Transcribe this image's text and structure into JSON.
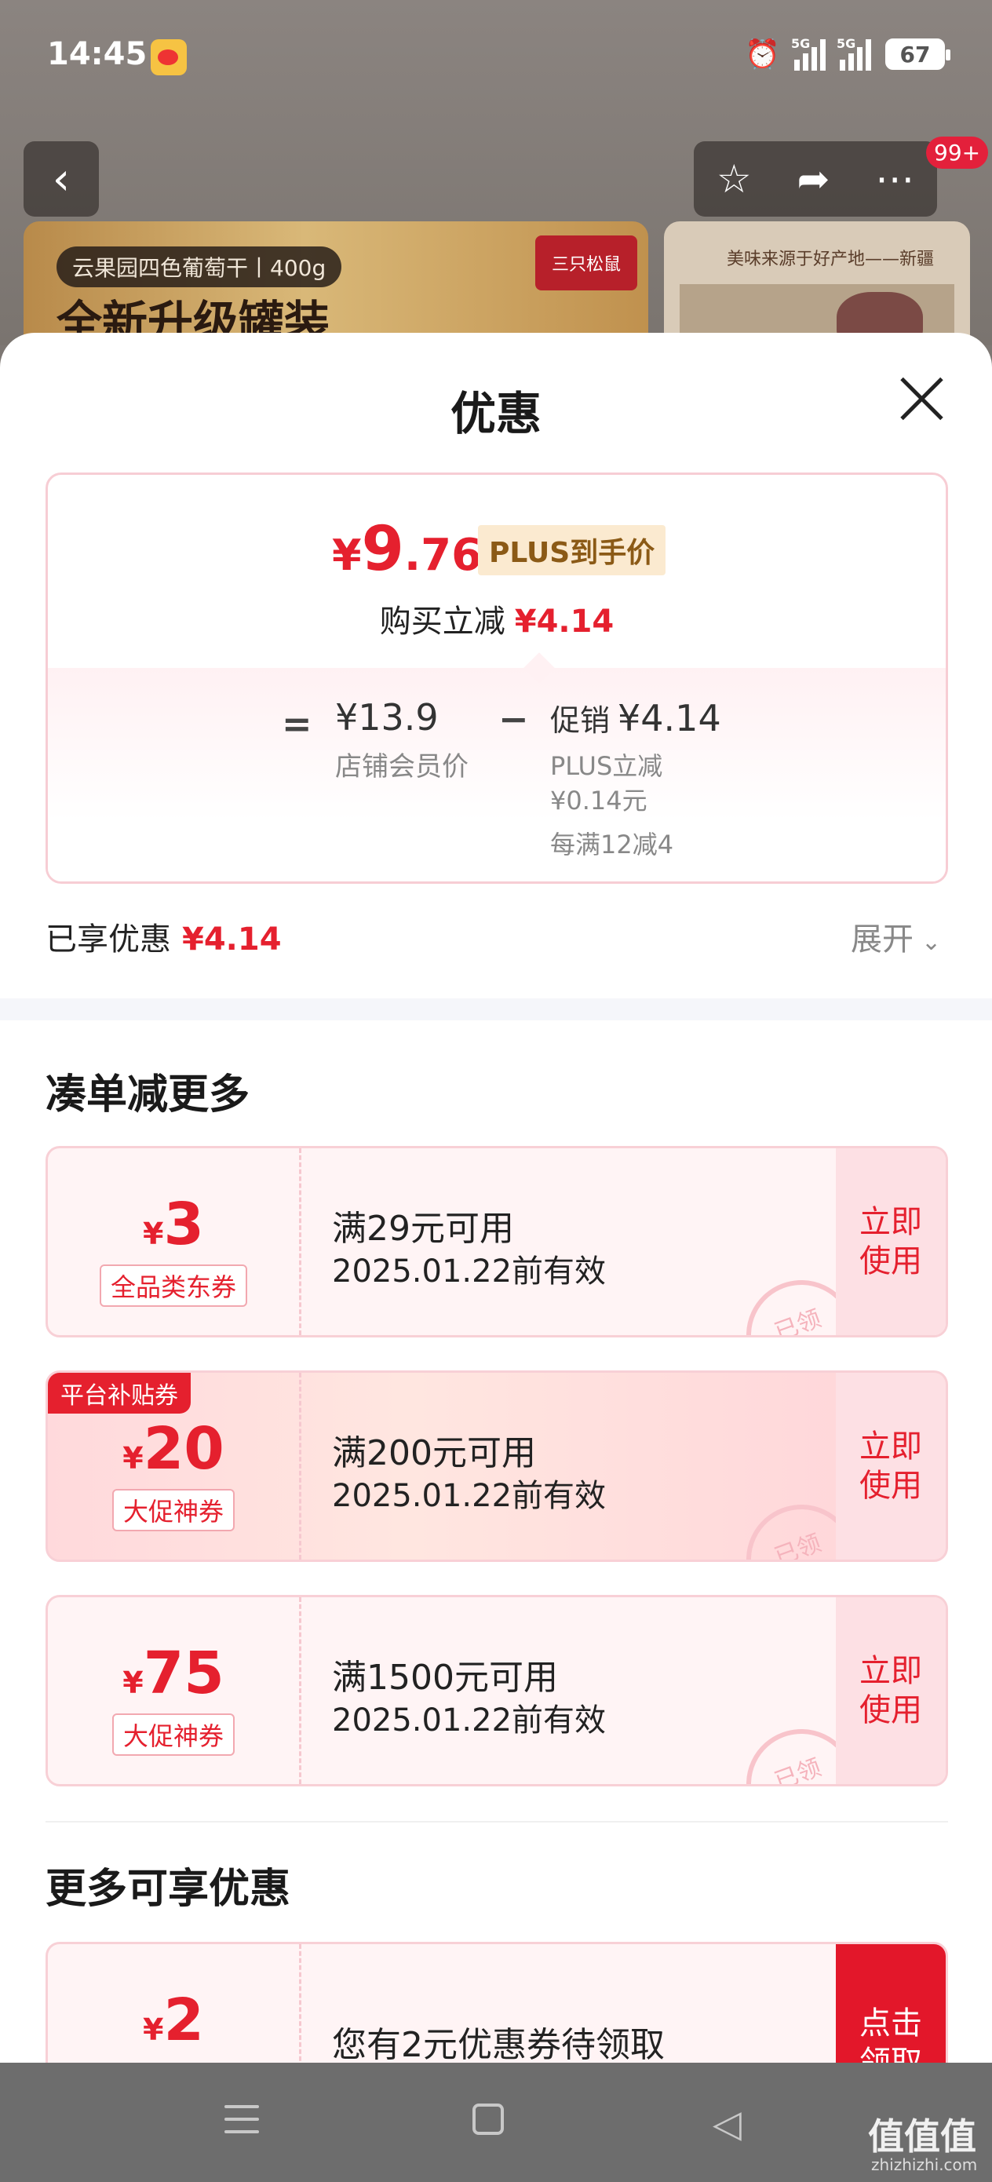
{
  "status": {
    "time": "14:45",
    "net1": "5G",
    "net2": "5G",
    "battery": "67"
  },
  "topnav": {
    "badge": "99+"
  },
  "background_product": {
    "pill": "云果园四色葡萄干丨400g",
    "headline": "全新升级罐装",
    "brand": "三只松鼠",
    "side_text": "美味来源于好产地——新疆"
  },
  "sheet": {
    "title": "优惠"
  },
  "price_box": {
    "currency": "¥",
    "price_int": "9",
    "price_dec": ".76",
    "plus_tag": "PLUS到手价",
    "reduce_label": "购买立减",
    "reduce_amount": "¥4.14",
    "equals": "=",
    "member_price": "¥13.9",
    "member_label": "店铺会员价",
    "minus": "−",
    "promo_label": "促销",
    "promo_amount": "¥4.14",
    "plus_reduce": "PLUS立减",
    "plus_reduce_amount": "¥0.14元",
    "rule": "每满12减4"
  },
  "enjoyed": {
    "label": "已享优惠",
    "amount": "¥4.14",
    "expand": "展开",
    "chevron": "⌄"
  },
  "section1": {
    "title": "凑单减更多"
  },
  "coupons": [
    {
      "currency": "¥",
      "amount": "3",
      "kind": "全品类东券",
      "condition": "满29元可用",
      "date": "2025.01.22前有效",
      "action_line1": "立即",
      "action_line2": "使用",
      "stamp": "已领"
    },
    {
      "platform_tag": "平台补贴券",
      "currency": "¥",
      "amount": "20",
      "kind": "大促神券",
      "condition": "满200元可用",
      "date": "2025.01.22前有效",
      "action_line1": "立即",
      "action_line2": "使用",
      "stamp": "已领"
    },
    {
      "currency": "¥",
      "amount": "75",
      "kind": "大促神券",
      "condition": "满1500元可用",
      "date": "2025.01.22前有效",
      "action_line1": "立即",
      "action_line2": "使用",
      "stamp": "已领"
    }
  ],
  "section2": {
    "title": "更多可享优惠"
  },
  "more_coupon": {
    "currency": "¥",
    "amount": "2",
    "text": "您有2元优惠券待领取",
    "action_line1": "点击",
    "action_line2": "领取"
  },
  "watermark": {
    "main": "值值值",
    "sub": "zhizhizhi.com"
  },
  "colors": {
    "accent_red": "#e5202e",
    "plus_gold": "#8b5a16"
  }
}
